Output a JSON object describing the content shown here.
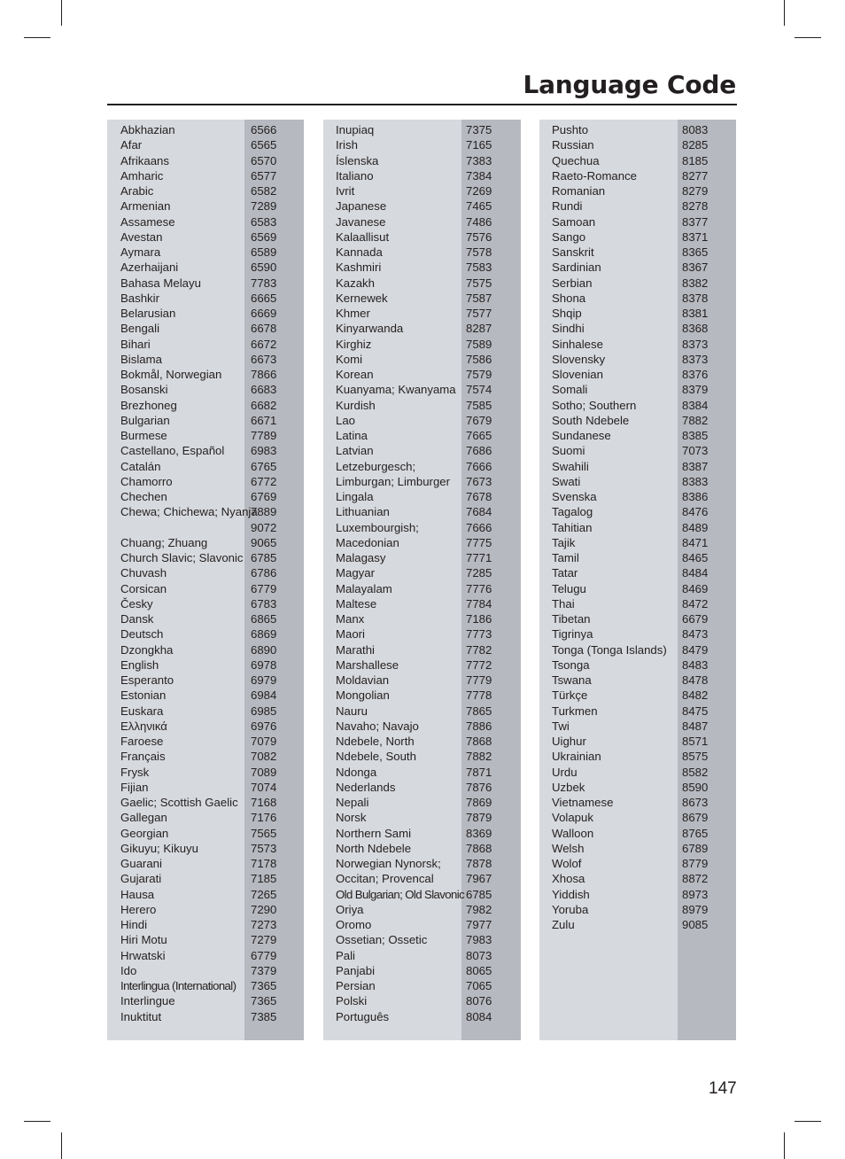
{
  "page": {
    "title": "Language Code",
    "page_number": "147"
  },
  "columns": [
    {
      "entries": [
        {
          "name": "Abkhazian",
          "code": "6566"
        },
        {
          "name": "Afar",
          "code": "6565"
        },
        {
          "name": "Afrikaans",
          "code": "6570"
        },
        {
          "name": "Amharic",
          "code": "6577"
        },
        {
          "name": "Arabic",
          "code": "6582"
        },
        {
          "name": "Armenian",
          "code": "7289"
        },
        {
          "name": "Assamese",
          "code": "6583"
        },
        {
          "name": "Avestan",
          "code": "6569"
        },
        {
          "name": "Aymara",
          "code": "6589"
        },
        {
          "name": "Azerhaijani",
          "code": "6590"
        },
        {
          "name": "Bahasa Melayu",
          "code": "7783"
        },
        {
          "name": "Bashkir",
          "code": "6665"
        },
        {
          "name": "Belarusian",
          "code": "6669"
        },
        {
          "name": "Bengali",
          "code": "6678"
        },
        {
          "name": "Bihari",
          "code": "6672"
        },
        {
          "name": "Bislama",
          "code": "6673"
        },
        {
          "name": "Bokmål, Norwegian",
          "code": "7866"
        },
        {
          "name": "Bosanski",
          "code": "6683"
        },
        {
          "name": "Brezhoneg",
          "code": "6682"
        },
        {
          "name": "Bulgarian",
          "code": "6671"
        },
        {
          "name": "Burmese",
          "code": "7789"
        },
        {
          "name": "Castellano, Español",
          "code": "6983"
        },
        {
          "name": "Catalán",
          "code": "6765"
        },
        {
          "name": "Chamorro",
          "code": "6772"
        },
        {
          "name": "Chechen",
          "code": "6769"
        },
        {
          "name": "Chewa; Chichewa; Nyanja",
          "code": "7889"
        },
        {
          "name": "",
          "code": "9072"
        },
        {
          "name": "Chuang; Zhuang",
          "code": "9065"
        },
        {
          "name": "Church Slavic; Slavonic",
          "code": "6785"
        },
        {
          "name": "Chuvash",
          "code": "6786"
        },
        {
          "name": "Corsican",
          "code": "6779"
        },
        {
          "name": "Česky",
          "code": "6783"
        },
        {
          "name": "Dansk",
          "code": "6865"
        },
        {
          "name": "Deutsch",
          "code": "6869"
        },
        {
          "name": "Dzongkha",
          "code": "6890"
        },
        {
          "name": "English",
          "code": "6978"
        },
        {
          "name": "Esperanto",
          "code": "6979"
        },
        {
          "name": "Estonian",
          "code": "6984"
        },
        {
          "name": "Euskara",
          "code": "6985"
        },
        {
          "name": "Ελληνικά",
          "code": "6976"
        },
        {
          "name": "Faroese",
          "code": "7079"
        },
        {
          "name": "Français",
          "code": "7082"
        },
        {
          "name": "Frysk",
          "code": "7089"
        },
        {
          "name": "Fijian",
          "code": "7074"
        },
        {
          "name": "Gaelic; Scottish Gaelic",
          "code": "7168"
        },
        {
          "name": "Gallegan",
          "code": "7176"
        },
        {
          "name": "Georgian",
          "code": "7565"
        },
        {
          "name": "Gikuyu; Kikuyu",
          "code": "7573"
        },
        {
          "name": "Guarani",
          "code": "7178"
        },
        {
          "name": "Gujarati",
          "code": "7185"
        },
        {
          "name": "Hausa",
          "code": "7265"
        },
        {
          "name": "Herero",
          "code": "7290"
        },
        {
          "name": "Hindi",
          "code": "7273"
        },
        {
          "name": "Hiri Motu",
          "code": "7279"
        },
        {
          "name": "Hrwatski",
          "code": "6779"
        },
        {
          "name": "Ido",
          "code": "7379"
        },
        {
          "name": "Interlingua (International)",
          "code": "7365"
        },
        {
          "name": "Interlingue",
          "code": "7365"
        },
        {
          "name": "Inuktitut",
          "code": "7385"
        }
      ]
    },
    {
      "entries": [
        {
          "name": "Inupiaq",
          "code": "7375"
        },
        {
          "name": "Irish",
          "code": "7165"
        },
        {
          "name": "Íslenska",
          "code": "7383"
        },
        {
          "name": "Italiano",
          "code": "7384"
        },
        {
          "name": "Ivrit",
          "code": "7269"
        },
        {
          "name": "Japanese",
          "code": "7465"
        },
        {
          "name": "Javanese",
          "code": "7486"
        },
        {
          "name": "Kalaallisut",
          "code": "7576"
        },
        {
          "name": "Kannada",
          "code": "7578"
        },
        {
          "name": "Kashmiri",
          "code": "7583"
        },
        {
          "name": "Kazakh",
          "code": "7575"
        },
        {
          "name": "Kernewek",
          "code": "7587"
        },
        {
          "name": "Khmer",
          "code": "7577"
        },
        {
          "name": "Kinyarwanda",
          "code": "8287"
        },
        {
          "name": "Kirghiz",
          "code": "7589"
        },
        {
          "name": "Komi",
          "code": "7586"
        },
        {
          "name": "Korean",
          "code": "7579"
        },
        {
          "name": "Kuanyama; Kwanyama",
          "code": "7574"
        },
        {
          "name": "Kurdish",
          "code": "7585"
        },
        {
          "name": "Lao",
          "code": "7679"
        },
        {
          "name": "Latina",
          "code": "7665"
        },
        {
          "name": "Latvian",
          "code": "7686"
        },
        {
          "name": "Letzeburgesch;",
          "code": "7666"
        },
        {
          "name": "Limburgan; Limburger",
          "code": "7673"
        },
        {
          "name": "Lingala",
          "code": "7678"
        },
        {
          "name": "Lithuanian",
          "code": "7684"
        },
        {
          "name": "Luxembourgish;",
          "code": "7666"
        },
        {
          "name": "Macedonian",
          "code": "7775"
        },
        {
          "name": "Malagasy",
          "code": "7771"
        },
        {
          "name": "Magyar",
          "code": "7285"
        },
        {
          "name": "Malayalam",
          "code": "7776"
        },
        {
          "name": "Maltese",
          "code": "7784"
        },
        {
          "name": "Manx",
          "code": "7186"
        },
        {
          "name": "Maori",
          "code": "7773"
        },
        {
          "name": "Marathi",
          "code": "7782"
        },
        {
          "name": "Marshallese",
          "code": "7772"
        },
        {
          "name": "Moldavian",
          "code": "7779"
        },
        {
          "name": "Mongolian",
          "code": "7778"
        },
        {
          "name": "Nauru",
          "code": "7865"
        },
        {
          "name": "Navaho; Navajo",
          "code": "7886"
        },
        {
          "name": "Ndebele, North",
          "code": "7868"
        },
        {
          "name": "Ndebele, South",
          "code": "7882"
        },
        {
          "name": "Ndonga",
          "code": "7871"
        },
        {
          "name": "Nederlands",
          "code": "7876"
        },
        {
          "name": "Nepali",
          "code": "7869"
        },
        {
          "name": "Norsk",
          "code": "7879"
        },
        {
          "name": "Northern Sami",
          "code": "8369"
        },
        {
          "name": "North Ndebele",
          "code": "7868"
        },
        {
          "name": "Norwegian Nynorsk;",
          "code": "7878"
        },
        {
          "name": "Occitan; Provencal",
          "code": "7967"
        },
        {
          "name": "Old Bulgarian; Old Slavonic",
          "code": "6785"
        },
        {
          "name": "Oriya",
          "code": "7982"
        },
        {
          "name": "Oromo",
          "code": "7977"
        },
        {
          "name": "Ossetian; Ossetic",
          "code": "7983"
        },
        {
          "name": "Pali",
          "code": "8073"
        },
        {
          "name": "Panjabi",
          "code": "8065"
        },
        {
          "name": "Persian",
          "code": "7065"
        },
        {
          "name": "Polski",
          "code": "8076"
        },
        {
          "name": "Português",
          "code": "8084"
        }
      ]
    },
    {
      "entries": [
        {
          "name": "Pushto",
          "code": "8083"
        },
        {
          "name": "Russian",
          "code": "8285"
        },
        {
          "name": "Quechua",
          "code": "8185"
        },
        {
          "name": "Raeto-Romance",
          "code": "8277"
        },
        {
          "name": "Romanian",
          "code": "8279"
        },
        {
          "name": "Rundi",
          "code": "8278"
        },
        {
          "name": "Samoan",
          "code": "8377"
        },
        {
          "name": "Sango",
          "code": "8371"
        },
        {
          "name": "Sanskrit",
          "code": "8365"
        },
        {
          "name": "Sardinian",
          "code": "8367"
        },
        {
          "name": "Serbian",
          "code": "8382"
        },
        {
          "name": "Shona",
          "code": "8378"
        },
        {
          "name": "Shqip",
          "code": "8381"
        },
        {
          "name": "Sindhi",
          "code": "8368"
        },
        {
          "name": "Sinhalese",
          "code": "8373"
        },
        {
          "name": "Slovensky",
          "code": "8373"
        },
        {
          "name": "Slovenian",
          "code": "8376"
        },
        {
          "name": "Somali",
          "code": "8379"
        },
        {
          "name": "Sotho; Southern",
          "code": "8384"
        },
        {
          "name": "South Ndebele",
          "code": "7882"
        },
        {
          "name": "Sundanese",
          "code": "8385"
        },
        {
          "name": "Suomi",
          "code": "7073"
        },
        {
          "name": "Swahili",
          "code": "8387"
        },
        {
          "name": "Swati",
          "code": "8383"
        },
        {
          "name": "Svenska",
          "code": "8386"
        },
        {
          "name": "Tagalog",
          "code": "8476"
        },
        {
          "name": "Tahitian",
          "code": "8489"
        },
        {
          "name": "Tajik",
          "code": "8471"
        },
        {
          "name": "Tamil",
          "code": "8465"
        },
        {
          "name": "Tatar",
          "code": "8484"
        },
        {
          "name": "Telugu",
          "code": "8469"
        },
        {
          "name": "Thai",
          "code": "8472"
        },
        {
          "name": "Tibetan",
          "code": "6679"
        },
        {
          "name": "Tigrinya",
          "code": "8473"
        },
        {
          "name": "Tonga (Tonga Islands)",
          "code": "8479"
        },
        {
          "name": "Tsonga",
          "code": "8483"
        },
        {
          "name": "Tswana",
          "code": "8478"
        },
        {
          "name": "Türkçe",
          "code": "8482"
        },
        {
          "name": "Turkmen",
          "code": "8475"
        },
        {
          "name": "Twi",
          "code": "8487"
        },
        {
          "name": "Uighur",
          "code": "8571"
        },
        {
          "name": "Ukrainian",
          "code": "8575"
        },
        {
          "name": "Urdu",
          "code": "8582"
        },
        {
          "name": "Uzbek",
          "code": "8590"
        },
        {
          "name": "Vietnamese",
          "code": "8673"
        },
        {
          "name": "Volapuk",
          "code": "8679"
        },
        {
          "name": "Walloon",
          "code": "8765"
        },
        {
          "name": "Welsh",
          "code": "6789"
        },
        {
          "name": "Wolof",
          "code": "8779"
        },
        {
          "name": "Xhosa",
          "code": "8872"
        },
        {
          "name": "Yiddish",
          "code": "8973"
        },
        {
          "name": "Yoruba",
          "code": "8979"
        },
        {
          "name": "Zulu",
          "code": "9085"
        }
      ]
    }
  ]
}
